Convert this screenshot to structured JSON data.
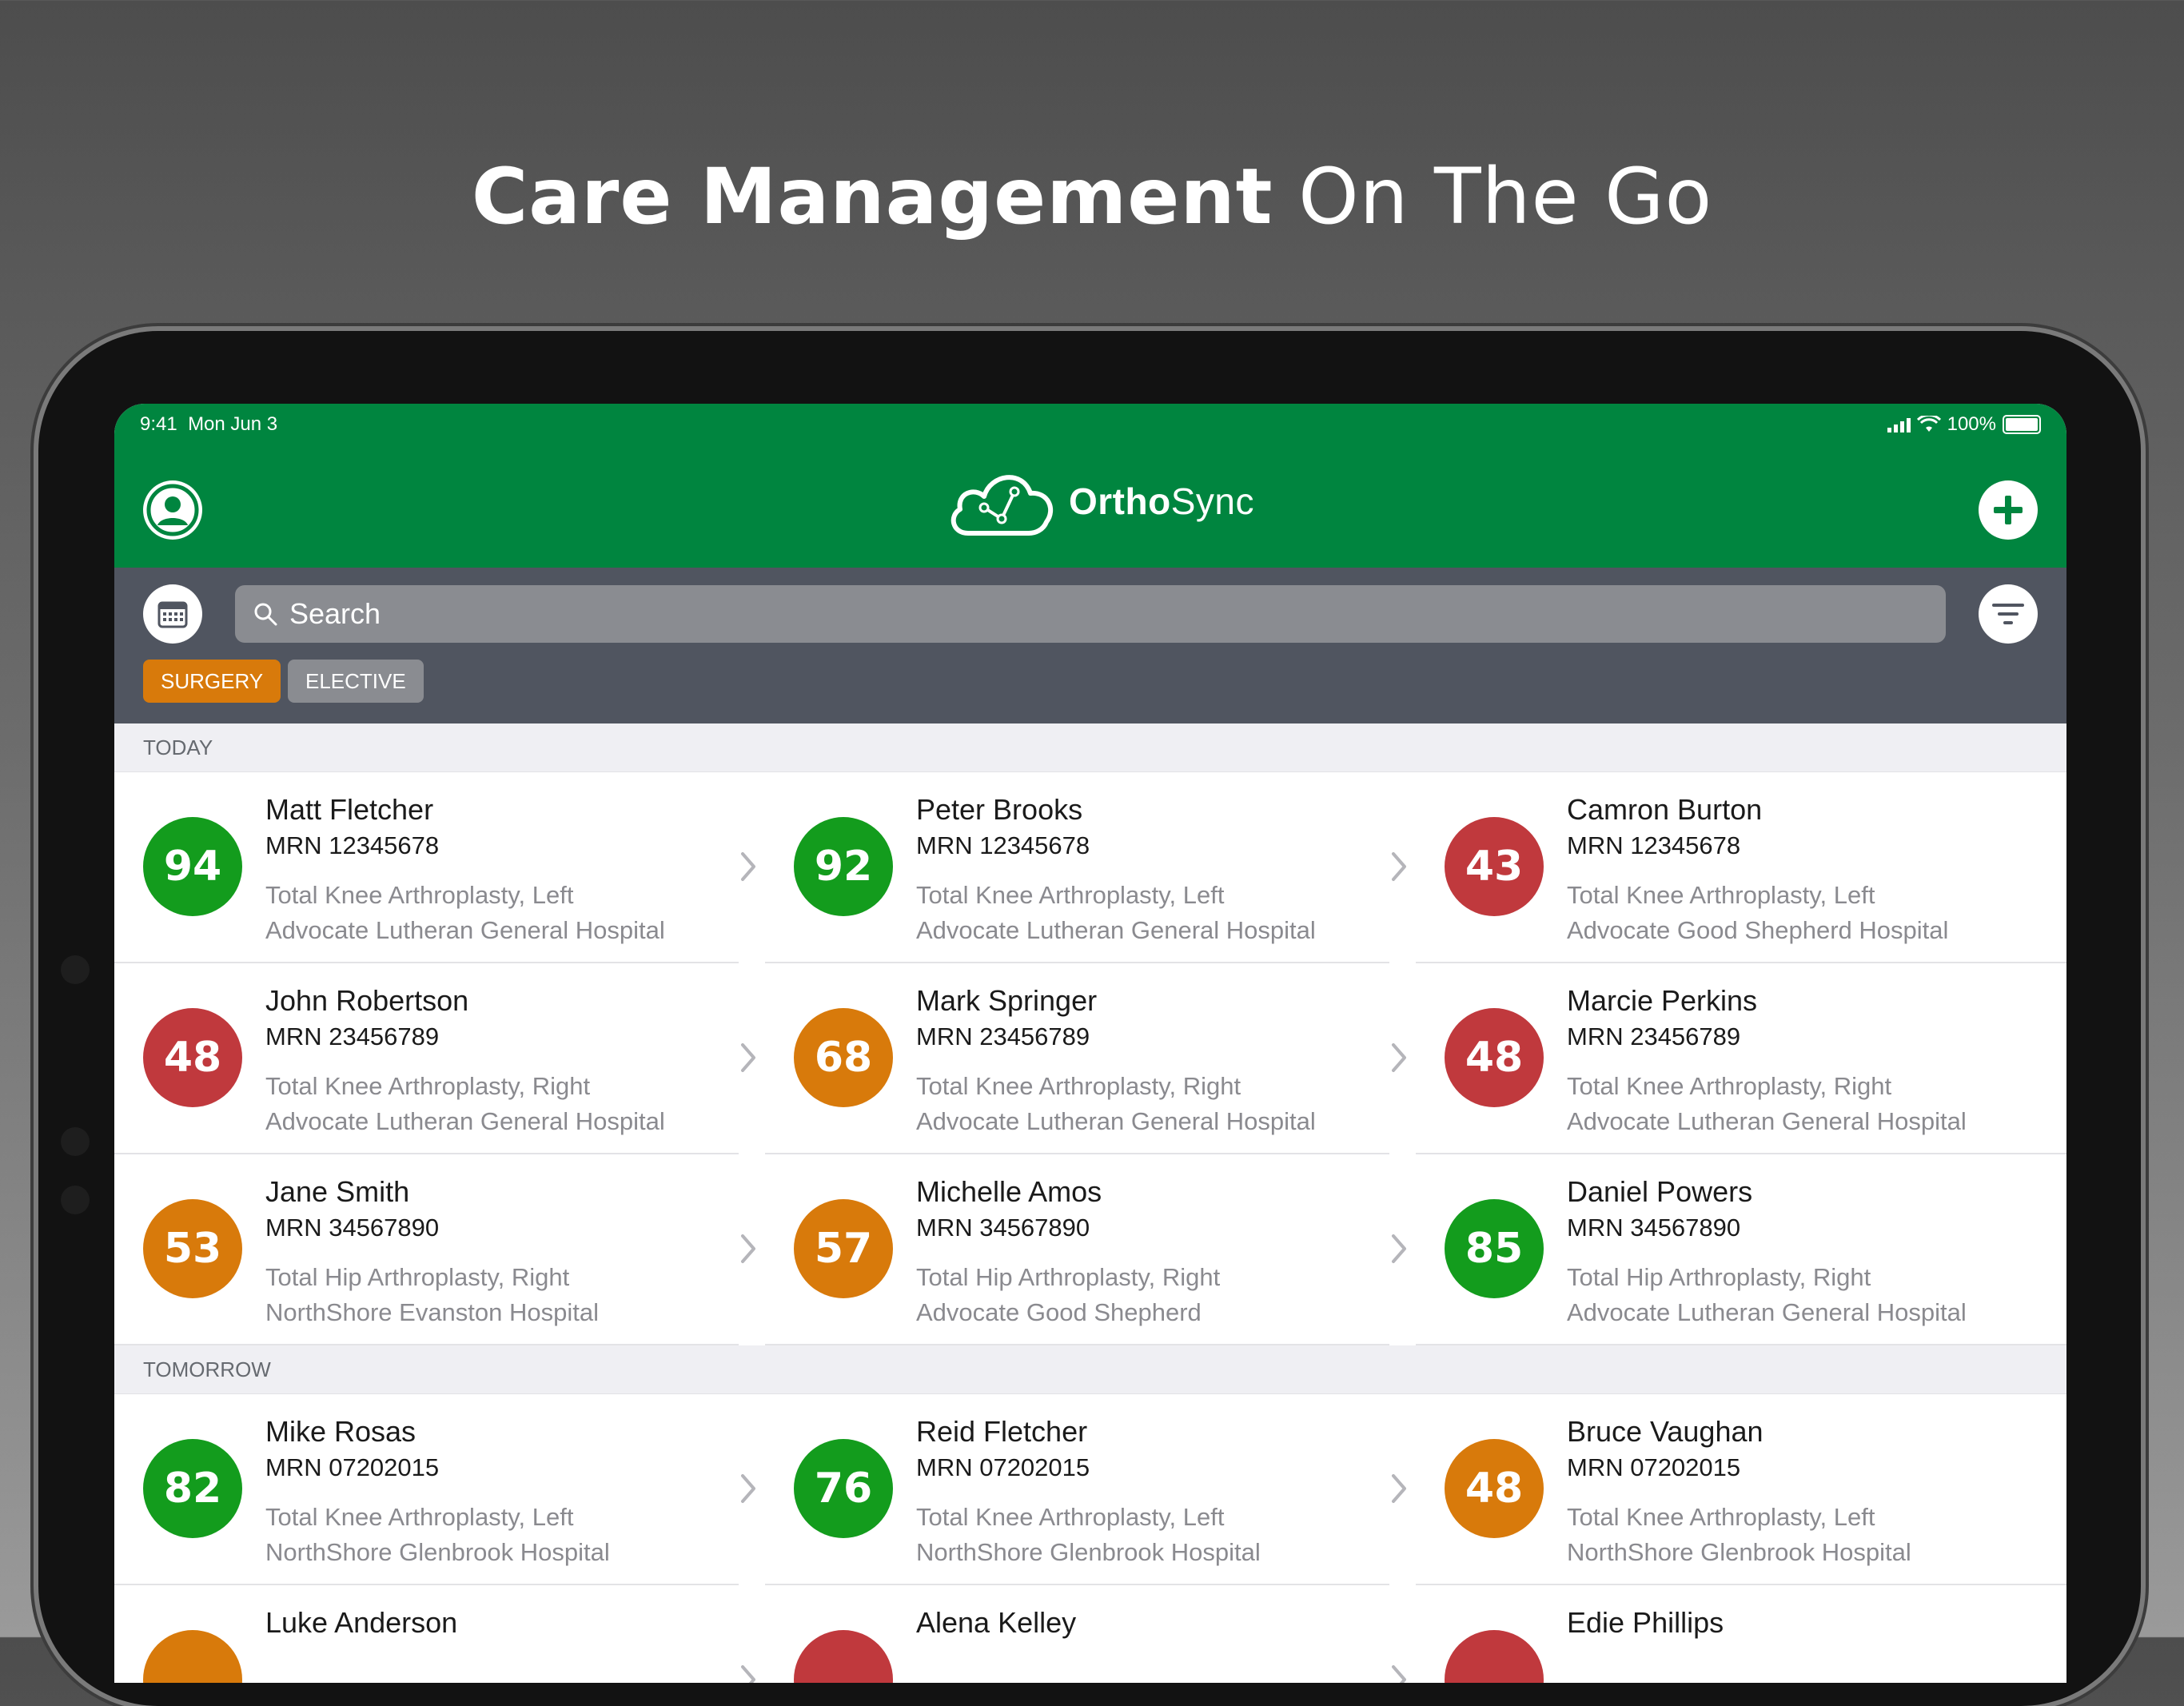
{
  "headline": {
    "bold": "Care Management",
    "regular": "On The Go"
  },
  "status": {
    "time": "9:41",
    "date": "Mon Jun 3",
    "battery": "100%"
  },
  "header": {
    "app_name_bold": "Ortho",
    "app_name_light": "Sync"
  },
  "search": {
    "placeholder": "Search"
  },
  "segments": [
    {
      "label": "SURGERY",
      "active": true
    },
    {
      "label": "ELECTIVE",
      "active": false
    }
  ],
  "colors": {
    "green": "#00853f",
    "red": "#c0393d",
    "orange": "#d87a0b",
    "scoreGreen": "#139c1d"
  },
  "sections": [
    {
      "title": "TODAY",
      "patients": [
        {
          "score": "94",
          "level": "green",
          "name": "Matt Fletcher",
          "mrn": "MRN 12345678",
          "procedure": "Total Knee Arthroplasty, Left",
          "hospital": "Advocate Lutheran General Hospital"
        },
        {
          "score": "92",
          "level": "green",
          "name": "Peter Brooks",
          "mrn": "MRN 12345678",
          "procedure": "Total Knee Arthroplasty, Left",
          "hospital": "Advocate Lutheran General Hospital"
        },
        {
          "score": "43",
          "level": "red",
          "name": "Camron Burton",
          "mrn": "MRN 12345678",
          "procedure": "Total Knee Arthroplasty, Left",
          "hospital": "Advocate Good Shepherd Hospital"
        },
        {
          "score": "48",
          "level": "red",
          "name": "John Robertson",
          "mrn": "MRN 23456789",
          "procedure": "Total Knee Arthroplasty, Right",
          "hospital": "Advocate Lutheran General Hospital"
        },
        {
          "score": "68",
          "level": "orange",
          "name": "Mark Springer",
          "mrn": "MRN 23456789",
          "procedure": "Total Knee Arthroplasty, Right",
          "hospital": "Advocate Lutheran General Hospital"
        },
        {
          "score": "48",
          "level": "red",
          "name": "Marcie Perkins",
          "mrn": "MRN 23456789",
          "procedure": "Total Knee Arthroplasty, Right",
          "hospital": "Advocate Lutheran General Hospital"
        },
        {
          "score": "53",
          "level": "orange",
          "name": "Jane Smith",
          "mrn": "MRN 34567890",
          "procedure": "Total Hip Arthroplasty, Right",
          "hospital": "NorthShore Evanston Hospital"
        },
        {
          "score": "57",
          "level": "orange",
          "name": "Michelle Amos",
          "mrn": "MRN 34567890",
          "procedure": "Total Hip Arthroplasty, Right",
          "hospital": "Advocate Good Shepherd"
        },
        {
          "score": "85",
          "level": "green",
          "name": "Daniel Powers",
          "mrn": "MRN 34567890",
          "procedure": "Total Hip Arthroplasty, Right",
          "hospital": "Advocate Lutheran General Hospital"
        }
      ]
    },
    {
      "title": "TOMORROW",
      "patients": [
        {
          "score": "82",
          "level": "green",
          "name": "Mike Rosas",
          "mrn": "MRN 07202015",
          "procedure": "Total Knee Arthroplasty, Left",
          "hospital": "NorthShore Glenbrook Hospital"
        },
        {
          "score": "76",
          "level": "green",
          "name": "Reid Fletcher",
          "mrn": "MRN 07202015",
          "procedure": "Total Knee Arthroplasty, Left",
          "hospital": "NorthShore Glenbrook Hospital"
        },
        {
          "score": "48",
          "level": "orange",
          "name": "Bruce Vaughan",
          "mrn": "MRN 07202015",
          "procedure": "Total Knee Arthroplasty, Left",
          "hospital": "NorthShore Glenbrook Hospital"
        },
        {
          "score": "",
          "level": "orange",
          "name": "Luke Anderson",
          "mrn": "",
          "procedure": "",
          "hospital": ""
        },
        {
          "score": "",
          "level": "red",
          "name": "Alena Kelley",
          "mrn": "",
          "procedure": "",
          "hospital": ""
        },
        {
          "score": "",
          "level": "red",
          "name": "Edie Phillips",
          "mrn": "",
          "procedure": "",
          "hospital": ""
        }
      ]
    }
  ]
}
